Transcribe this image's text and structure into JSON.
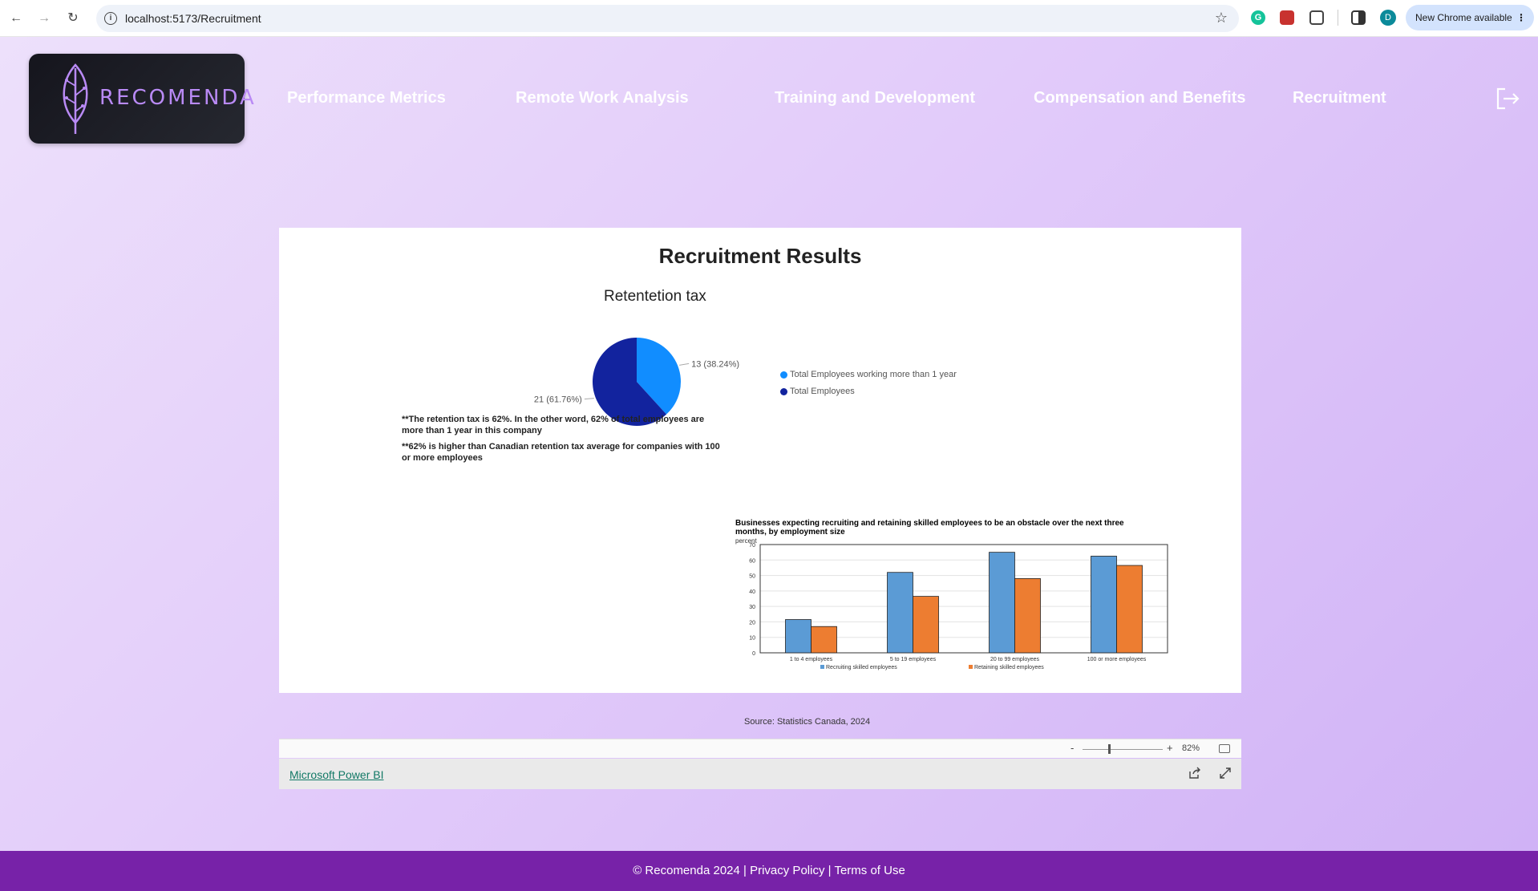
{
  "browser": {
    "url": "localhost:5173/Recruitment",
    "profile_initial": "D",
    "new_chrome_label": "New Chrome available"
  },
  "app": {
    "logo_text": "RECOMENDA",
    "nav": [
      {
        "label": "Performance Metrics"
      },
      {
        "label": "Remote Work Analysis"
      },
      {
        "label": "Training and Development"
      },
      {
        "label": "Compensation and Benefits"
      },
      {
        "label": "Recruitment"
      }
    ]
  },
  "report": {
    "title": "Recruitment Results",
    "pie_title": "Retentetion tax",
    "pie_label_a": "13 (38.24%)",
    "pie_label_b": "21 (61.76%)",
    "legend": [
      {
        "label": "Total Employees  working more than 1 year",
        "color": "#118dff"
      },
      {
        "label": "Total Employees",
        "color": "#12239e"
      }
    ],
    "note1": "**The retention tax is 62%. In the other word, 62% of total employees are more than 1 year in this company",
    "note2": "**62% is higher than Canadian retention tax average for companies with 100 or more employees",
    "source": "Source: Statistics Canada, 2024",
    "zoom_minus": "-",
    "zoom_plus": "+",
    "zoom_level": "82%",
    "powerbi_link": "Microsoft Power BI"
  },
  "chart_data": [
    {
      "type": "pie",
      "title": "Retentetion tax",
      "categories": [
        "Total Employees  working more than 1 year",
        "Total Employees"
      ],
      "values": [
        13,
        21
      ],
      "labels": [
        "13 (38.24%)",
        "21 (61.76%)"
      ],
      "colors": [
        "#118dff",
        "#12239e"
      ],
      "legend_position": "right"
    },
    {
      "type": "bar",
      "title": "Businesses expecting recruiting  and retaining  skilled  employees to be an obstacle over the next three months, by employment size",
      "ylabel": "percent",
      "categories": [
        "1 to 4 employees",
        "5 to 19 employees",
        "20 to 99 employees",
        "100 or more employees"
      ],
      "series": [
        {
          "name": "Recruiting skilled employees",
          "values": [
            21.5,
            52,
            65,
            62.5
          ],
          "color": "#5b9bd5"
        },
        {
          "name": "Retaining skilled employees",
          "values": [
            17,
            36.5,
            48,
            56.5
          ],
          "color": "#ed7d31"
        }
      ],
      "ylim": [
        0,
        70
      ],
      "yticks": [
        "0",
        "10",
        "20",
        "30",
        "40",
        "50",
        "60",
        "70"
      ],
      "grid": true,
      "legend_position": "bottom"
    }
  ],
  "footer": {
    "copyright": "© Recomenda 2024",
    "sep": "|",
    "privacy": "Privacy Policy",
    "terms": "Terms of Use"
  }
}
